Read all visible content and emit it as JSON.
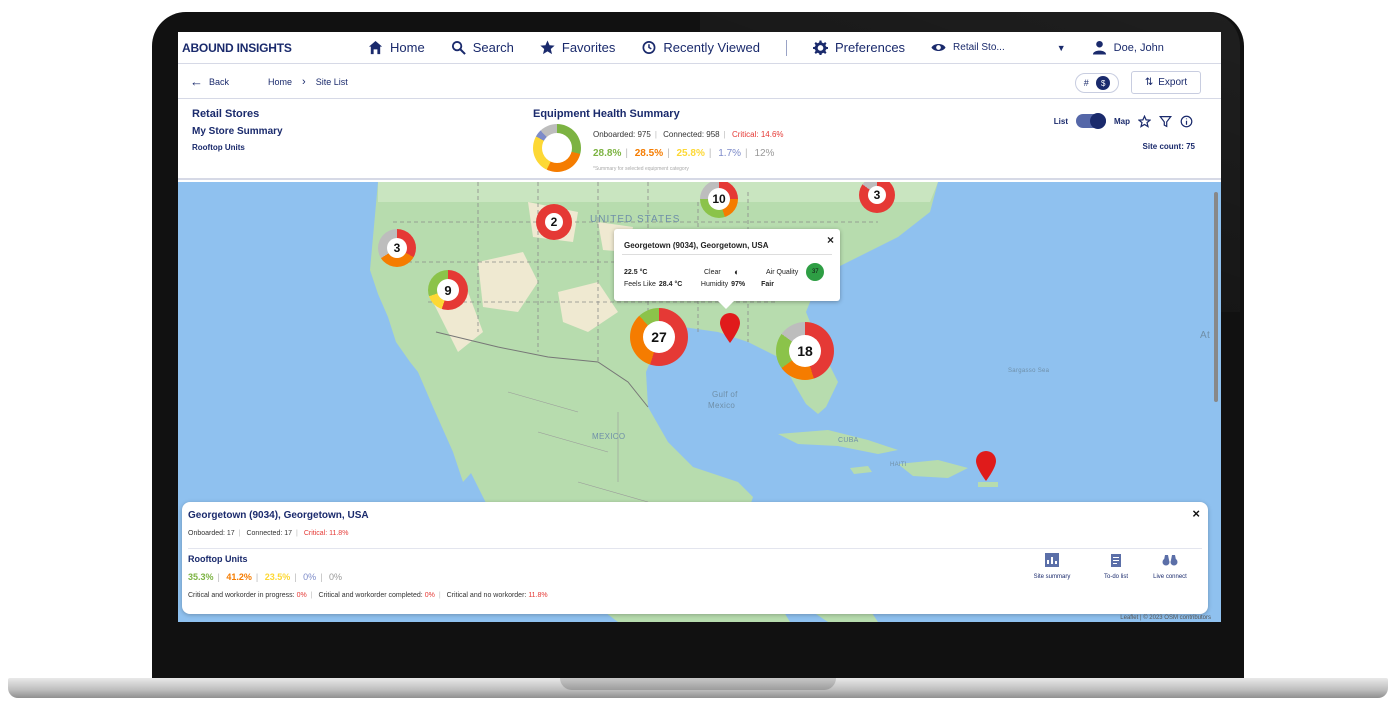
{
  "nav": {
    "brand": "ABOUND INSIGHTS",
    "home": "Home",
    "search": "Search",
    "favorites": "Favorites",
    "recent": "Recently Viewed",
    "preferences": "Preferences",
    "view_selector": "Retail Sto...",
    "user": "Doe, John"
  },
  "crumbs": {
    "back": "Back",
    "home": "Home",
    "current": "Site List",
    "pill_label": "#",
    "pill_value": "$",
    "export": "Export"
  },
  "context": {
    "line1": "Retail Stores",
    "line2": "My Store Summary",
    "line3": "Rooftop Units"
  },
  "health": {
    "title": "Equipment Health Summary",
    "onboarded": "Onboarded: 975",
    "connected": "Connected: 958",
    "critical": "Critical: 14.6%",
    "pct": [
      "28.8%",
      "28.5%",
      "25.8%",
      "1.7%",
      "12%"
    ],
    "note": "*Summary for selected equipment category"
  },
  "view": {
    "list": "List",
    "map": "Map",
    "site_count": "Site count: 75"
  },
  "map": {
    "labels": {
      "us": "UNITED STATES",
      "gulf1": "Gulf of",
      "gulf2": "Mexico",
      "mexico": "MEXICO",
      "cuba": "CUBA",
      "haiti": "HAITI",
      "sargasso": "Sargasso Sea",
      "atl": "At"
    },
    "clusters": [
      "2",
      "10",
      "3",
      "3",
      "9",
      "27",
      "18"
    ],
    "attribution": "Leaflet | © 2023 OSM contributors"
  },
  "tooltip": {
    "title": "Georgetown (9034), Georgetown, USA",
    "temp": "22.5 °C",
    "sky": "Clear",
    "aq_label": "Air Quality",
    "aq_value": "37",
    "feels_label": "Feels Like",
    "feels_value": "28.4 °C",
    "humidity_label": "Humidity",
    "humidity_value": "97%",
    "aq_text": "Fair"
  },
  "info": {
    "title": "Georgetown (9034), Georgetown, USA",
    "onboarded": "Onboarded: 17",
    "connected": "Connected: 17",
    "critical": "Critical: 11.8%",
    "category": "Rooftop Units",
    "pct": [
      "35.3%",
      "41.2%",
      "23.5%",
      "0%",
      "0%"
    ],
    "wo_progress_label": "Critical and workorder in progress:",
    "wo_progress": "0%",
    "wo_completed_label": "Critical and workorder completed:",
    "wo_completed": "0%",
    "no_wo_label": "Critical and no workorder:",
    "no_wo": "11.8%",
    "actions": [
      "Site summary",
      "To-do list",
      "Live connect"
    ]
  }
}
